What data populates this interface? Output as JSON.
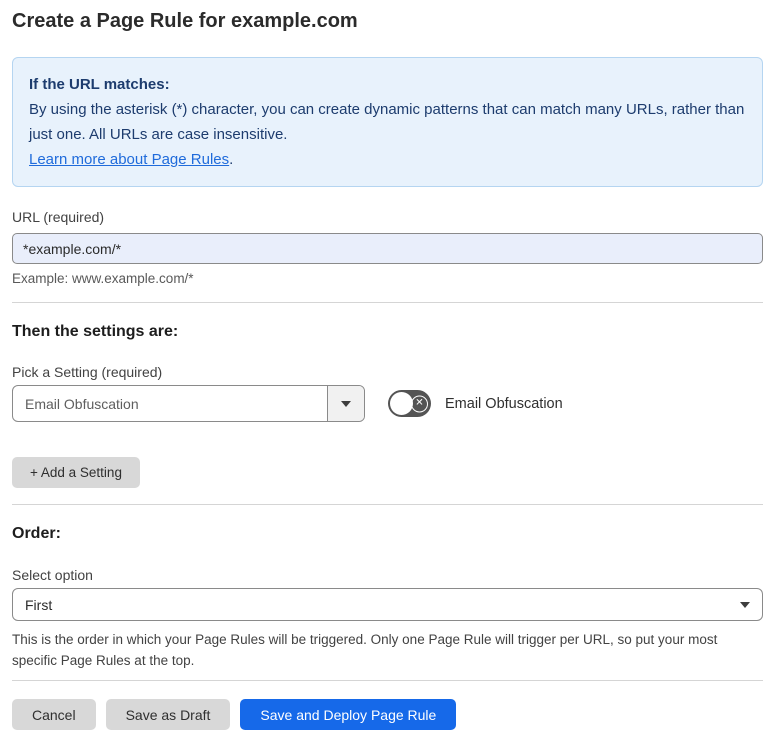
{
  "page": {
    "title": "Create a Page Rule for example.com"
  },
  "info_box": {
    "heading": "If the URL matches:",
    "body": "By using the asterisk (*) character, you can create dynamic patterns that can match many URLs, rather than just one. All URLs are case insensitive.",
    "link_label": "Learn more about Page Rules",
    "link_suffix": "."
  },
  "url_section": {
    "label": "URL (required)",
    "value": "*example.com/*",
    "example": "Example: www.example.com/*"
  },
  "settings_section": {
    "heading": "Then the settings are:",
    "pick_label": "Pick a Setting (required)",
    "selected_setting": "Email Obfuscation",
    "toggle_label": "Email Obfuscation",
    "toggle_state": "off",
    "toggle_x_glyph": "✕",
    "add_button_label": "+ Add a Setting"
  },
  "order_section": {
    "heading": "Order:",
    "select_label": "Select option",
    "selected_option": "First",
    "description": "This is the order in which your Page Rules will be triggered. Only one Page Rule will trigger per URL, so put your most specific Page Rules at the top."
  },
  "footer": {
    "cancel_label": "Cancel",
    "save_draft_label": "Save as Draft",
    "save_deploy_label": "Save and Deploy Page Rule"
  },
  "colors": {
    "info_background": "#e8f2fc",
    "info_border": "#b5d5f1",
    "info_text": "#1d3c6e",
    "link_blue": "#1f6bdb",
    "url_input_background": "#e9eefb",
    "primary_button_blue": "#1669e9",
    "gray_button": "#d8d8d8",
    "toggle_off_background": "#545454"
  }
}
